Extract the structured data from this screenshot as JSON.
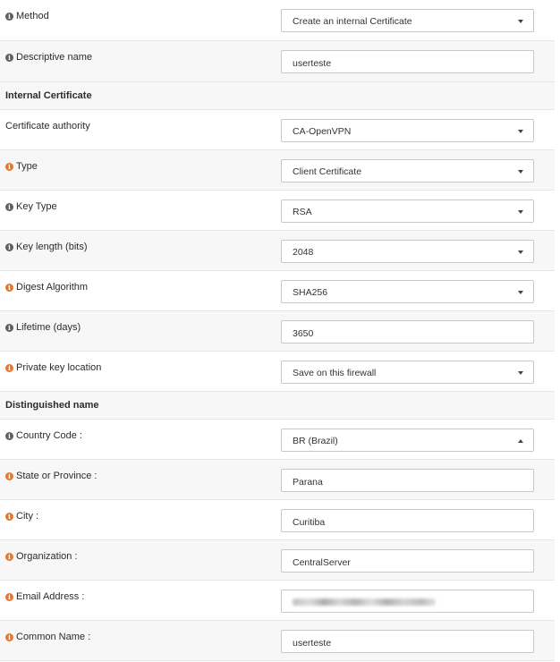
{
  "fields": {
    "method": {
      "label": "Method",
      "value": "Create an internal Certificate"
    },
    "descriptive_name": {
      "label": "Descriptive name",
      "value": "userteste"
    },
    "internal_certificate_header": "Internal Certificate",
    "certificate_authority": {
      "label": "Certificate authority",
      "value": "CA-OpenVPN"
    },
    "type": {
      "label": "Type",
      "value": "Client Certificate"
    },
    "key_type": {
      "label": "Key Type",
      "value": "RSA"
    },
    "key_length": {
      "label": "Key length (bits)",
      "value": "2048"
    },
    "digest_algorithm": {
      "label": "Digest Algorithm",
      "value": "SHA256"
    },
    "lifetime": {
      "label": "Lifetime (days)",
      "value": "3650"
    },
    "private_key_location": {
      "label": "Private key location",
      "value": "Save on this firewall"
    },
    "distinguished_name_header": "Distinguished name",
    "country_code": {
      "label": "Country Code :",
      "value": "BR (Brazil)"
    },
    "state": {
      "label": "State or Province :",
      "value": "Parana"
    },
    "city": {
      "label": "City :",
      "value": "Curitiba"
    },
    "organization": {
      "label": "Organization :",
      "value": "CentralServer"
    },
    "email": {
      "label": "Email Address :",
      "value": ""
    },
    "common_name": {
      "label": "Common Name :",
      "value": "userteste"
    }
  },
  "info_icon_glyph": "i",
  "colors": {
    "info_gray": "#5f5f5f",
    "info_orange": "#e5772c",
    "row_alt": "#f7f7f7",
    "border": "#c8c8c8"
  }
}
